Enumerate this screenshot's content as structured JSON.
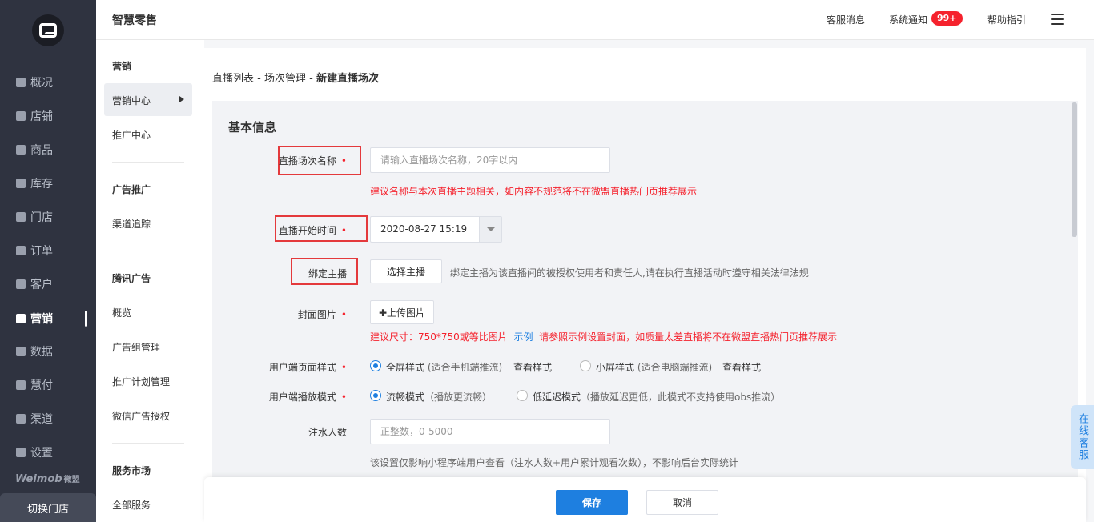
{
  "nav": {
    "items": [
      {
        "label": "概况",
        "icon": "overview-icon"
      },
      {
        "label": "店铺",
        "icon": "shop-icon"
      },
      {
        "label": "商品",
        "icon": "goods-icon"
      },
      {
        "label": "库存",
        "icon": "inventory-icon"
      },
      {
        "label": "门店",
        "icon": "store-icon"
      },
      {
        "label": "订单",
        "icon": "order-icon"
      },
      {
        "label": "客户",
        "icon": "customer-icon"
      },
      {
        "label": "营销",
        "icon": "marketing-icon"
      },
      {
        "label": "数据",
        "icon": "data-icon"
      },
      {
        "label": "慧付",
        "icon": "pay-icon"
      },
      {
        "label": "渠道",
        "icon": "channel-icon"
      },
      {
        "label": "设置",
        "icon": "settings-icon"
      }
    ],
    "brand": "Weimob",
    "brand_cn": "微盟",
    "switch_store": "切换门店"
  },
  "header": {
    "title": "智慧零售",
    "service_msg": "客服消息",
    "system_notice": "系统通知",
    "badge": "99+",
    "help": "帮助指引"
  },
  "sidebar": {
    "sections": [
      {
        "head": "营销",
        "items": [
          "营销中心",
          "推广中心"
        ]
      },
      {
        "head": "广告推广",
        "items": [
          "渠道追踪"
        ]
      },
      {
        "head": "腾讯广告",
        "items": [
          "概览",
          "广告组管理",
          "推广计划管理",
          "微信广告授权"
        ]
      },
      {
        "head": "服务市场",
        "items": [
          "全部服务"
        ]
      }
    ]
  },
  "breadcrumb": {
    "part1": "直播列表",
    "sep": " - ",
    "part2": "场次管理",
    "current": "新建直播场次"
  },
  "form": {
    "section_title": "基本信息",
    "name_label": "直播场次名称",
    "name_placeholder": "请输入直播场次名称，20字以内",
    "name_tip": "建议名称与本次直播主题相关，如内容不规范将不在微盟直播热门页推荐展示",
    "start_label": "直播开始时间",
    "start_value": "2020-08-27 15:19",
    "anchor_label": "绑定主播",
    "anchor_button": "选择主播",
    "anchor_tip": "绑定主播为该直播间的被授权使用者和责任人,请在执行直播活动时遵守相关法律法规",
    "cover_label": "封面图片",
    "cover_button": "✚上传图片",
    "cover_tip_a": "建议尺寸：750*750或等比图片",
    "cover_tip_link": "示例",
    "cover_tip_b": "请参照示例设置封面，如质量太差直播将不在微盟直播热门页推荐展示",
    "page_style_label": "用户端页面样式",
    "page_style_opt1": "全屏样式",
    "page_style_opt1_hint": "(适合手机端推流)",
    "page_style_opt2": "小屏样式",
    "page_style_opt2_hint": "(适合电脑端推流)",
    "view_style": "查看样式",
    "play_mode_label": "用户端播放模式",
    "play_mode_opt1": "流畅模式",
    "play_mode_opt1_hint": "（播放更流畅）",
    "play_mode_opt2": "低延迟模式",
    "play_mode_opt2_hint": "（播放延迟更低，此模式不支持使用obs推流）",
    "fake_viewers_label": "注水人数",
    "fake_viewers_placeholder": "正整数，0-5000",
    "fake_viewers_tip": "该设置仅影响小程序端用户查看（注水人数+用户累计观看次数），不影响后台实际统计",
    "required_mark": "•"
  },
  "footer": {
    "save": "保存",
    "cancel": "取消"
  },
  "online_service": "在线客服",
  "colors": {
    "primary": "#1e7fe0",
    "danger": "#f5222d",
    "nav_bg": "#2f3340"
  }
}
